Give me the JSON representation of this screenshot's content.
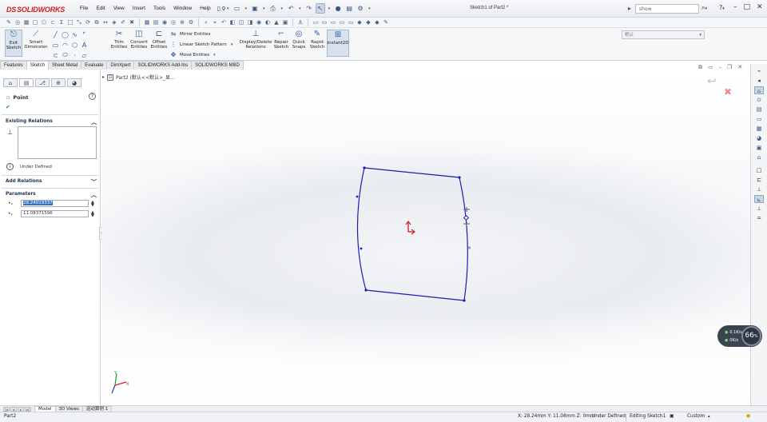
{
  "app": {
    "brand_prefix": "DS",
    "brand": "SOLIDWORKS",
    "doc_title": "Sketch1 of Part2 *",
    "menus": [
      "File",
      "Edit",
      "View",
      "Insert",
      "Tools",
      "Window",
      "Help"
    ],
    "search_value": "show",
    "help_label": "?",
    "window_buttons": [
      "–",
      "□",
      "✕"
    ]
  },
  "command_manager": {
    "exit_sketch": "Exit Sketch",
    "smart_dimension": "Smart Dimension",
    "trim_entities": "Trim Entities",
    "convert_entities": "Convert Entities",
    "offset_entities": "Offset Entities",
    "mirror_entities": "Mirror Entities",
    "linear_sketch_pattern": "Linear Sketch Pattern",
    "move_entities": "Move Entities",
    "display_delete_relations": "Display/Delete Relations",
    "repair_sketch": "Repair Sketch",
    "quick_snaps": "Quick Snaps",
    "rapid_sketch": "Rapid Sketch",
    "instant2d": "Instant2D",
    "config_dropdown": "默认"
  },
  "tabs": [
    "Features",
    "Sketch",
    "Sheet Metal",
    "Evaluate",
    "DimXpert",
    "SOLIDWORKS Add-Ins",
    "SOLIDWORKS MBD"
  ],
  "active_tab": "Sketch",
  "property_manager": {
    "title": "Point",
    "existing_relations": "Existing Relations",
    "status": "Under Defined",
    "add_relations": "Add Relations",
    "parameters": "Parameters",
    "param_x_value": "28.24019337",
    "param_y_value": "11.08371596"
  },
  "tree": {
    "text": "Part2 (默认<<默认>_显..."
  },
  "fps": {
    "line1_value": "0.1",
    "line1_unit": "K/s",
    "line2_value": "0",
    "line2_unit": "K/s",
    "percent": "66",
    "percent_unit": "%"
  },
  "bottom_tabs": [
    "Model",
    "3D Views",
    "运动算例 1"
  ],
  "active_bottom_tab": "Model",
  "status": {
    "doc": "Part2",
    "coords": "X: 28.24mm Y: 11.08mm Z: 0mm",
    "defined": "Under Defined",
    "editing": "Editing Sketch1",
    "units": "Custom"
  },
  "colors": {
    "sketch_line": "#1c1cb4",
    "origin": "#d01f1f",
    "brand": "#d02121",
    "ok_check": "#1a9a2b"
  },
  "icons": {
    "search": "search-icon",
    "help": "help-icon",
    "ok": "check-icon"
  }
}
